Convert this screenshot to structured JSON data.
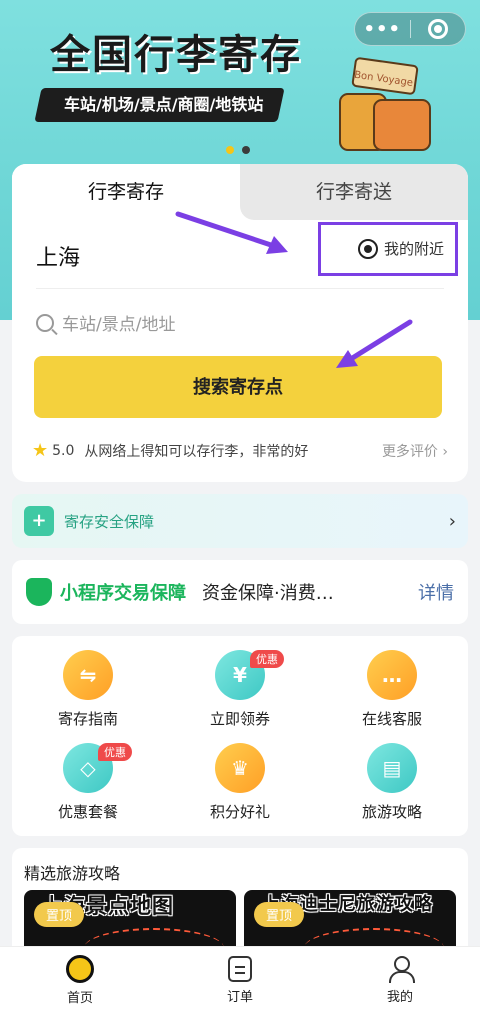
{
  "banner": {
    "title": "全国行李寄存",
    "subtitle": "车站/机场/景点/商圈/地铁站",
    "suitcase_text": "Bon Voyage"
  },
  "capsule": {
    "more_label": "•••"
  },
  "tabs": [
    {
      "label": "行李寄存",
      "active": true
    },
    {
      "label": "行李寄送",
      "active": false
    }
  ],
  "location": {
    "city": "上海",
    "nearby_label": "我的附近"
  },
  "search": {
    "placeholder": "车站/景点/地址",
    "button_label": "搜索寄存点"
  },
  "review": {
    "rating": "5.0",
    "text": "从网络上得知可以存行李，非常的好",
    "more_label": "更多评价"
  },
  "safety": {
    "label": "寄存安全保障",
    "icon_char": "+"
  },
  "guarantee": {
    "title": "小程序交易保障",
    "desc": "资金保障·消费…",
    "detail_label": "详情"
  },
  "grid": [
    {
      "label": "寄存指南",
      "icon": "signpost-icon",
      "glyph": "⇋",
      "color": "orange",
      "badge": ""
    },
    {
      "label": "立即领券",
      "icon": "coupon-icon",
      "glyph": "¥",
      "color": "teal",
      "badge": "优惠"
    },
    {
      "label": "在线客服",
      "icon": "chat-icon",
      "glyph": "…",
      "color": "orange",
      "badge": ""
    },
    {
      "label": "优惠套餐",
      "icon": "tag-icon",
      "glyph": "◇",
      "color": "teal",
      "badge": "优惠"
    },
    {
      "label": "积分好礼",
      "icon": "crown-icon",
      "glyph": "♛",
      "color": "orange",
      "badge": ""
    },
    {
      "label": "旅游攻略",
      "icon": "guidebook-icon",
      "glyph": "▤",
      "color": "teal",
      "badge": ""
    }
  ],
  "guides": {
    "title": "精选旅游攻略",
    "cards": [
      {
        "caption": "上海景点地图",
        "pin": "置顶"
      },
      {
        "caption": "上海迪士尼旅游攻略",
        "pin": "置顶"
      }
    ]
  },
  "tabbar": [
    {
      "label": "首页",
      "icon": "home-icon"
    },
    {
      "label": "订单",
      "icon": "order-icon"
    },
    {
      "label": "我的",
      "icon": "user-icon"
    }
  ],
  "colors": {
    "accent": "#f4d13d",
    "annotation": "#7b3fe4",
    "banner": "#6ed6d6",
    "safety_green": "#27a283",
    "guarantee_green": "#1bb55c"
  }
}
